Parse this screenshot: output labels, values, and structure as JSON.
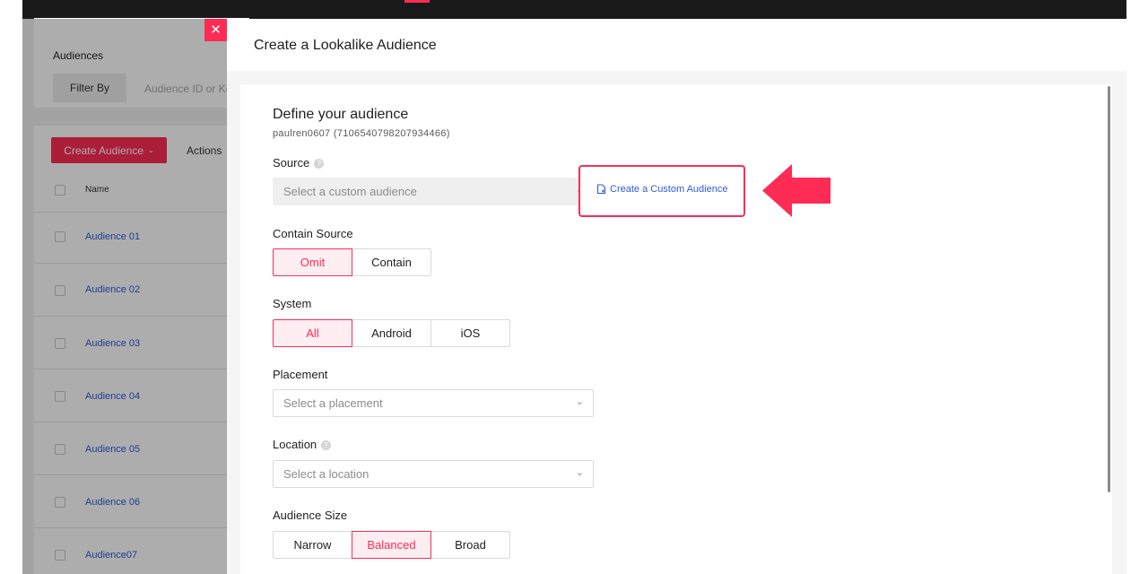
{
  "background": {
    "title": "Audiences",
    "filter_label": "Filter By",
    "search_placeholder": "Audience ID or Ke",
    "create_button": "Create Audience",
    "actions_label": "Actions",
    "column_name": "Name",
    "rows": [
      "Audience 01",
      "Audience 02",
      "Audience 03",
      "Audience 04",
      "Audience 05",
      "Audience 06",
      "Audience07"
    ]
  },
  "drawer": {
    "title": "Create a Lookalike Audience",
    "section_title": "Define your audience",
    "account_id": "paulren0607 (7106540798207934466)",
    "source": {
      "label": "Source",
      "placeholder": "Select a custom audience",
      "create_link": "Create a Custom Audience"
    },
    "contain_source": {
      "label": "Contain Source",
      "options": [
        "Omit",
        "Contain"
      ],
      "selected": "Omit"
    },
    "system": {
      "label": "System",
      "options": [
        "All",
        "Android",
        "iOS"
      ],
      "selected": "All"
    },
    "placement": {
      "label": "Placement",
      "placeholder": "Select a placement"
    },
    "location": {
      "label": "Location",
      "placeholder": "Select a location"
    },
    "audience_size": {
      "label": "Audience Size",
      "options": [
        "Narrow",
        "Balanced",
        "Broad"
      ],
      "selected": "Balanced"
    }
  },
  "icons": {
    "close": "close-icon",
    "help": "help-icon",
    "chevron": "chevron-down-icon",
    "doc": "document-add-icon",
    "arrow": "arrow-left-icon"
  },
  "colors": {
    "accent": "#fe2c55",
    "link": "#2f5cd6",
    "topbar": "#1a1a1a"
  }
}
